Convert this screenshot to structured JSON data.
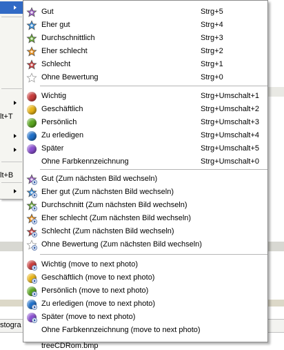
{
  "background": {
    "parent_menu_shortcuts": [
      "lt+T",
      "lt+B"
    ],
    "file_label": "treeCDRom.bmp",
    "histogram_label": "stogra"
  },
  "groups": [
    {
      "items": [
        {
          "label": "Gut",
          "shortcut": "Strg+5",
          "icon": "star-purple-icon",
          "color": "#9b5fc0"
        },
        {
          "label": "Eher gut",
          "shortcut": "Strg+4",
          "icon": "star-blue-icon",
          "color": "#3c8fd8"
        },
        {
          "label": "Durchschnittlich",
          "shortcut": "Strg+3",
          "icon": "star-green-icon",
          "color": "#6aa83a"
        },
        {
          "label": "Eher schlecht",
          "shortcut": "Strg+2",
          "icon": "star-orange-icon",
          "color": "#e8901e"
        },
        {
          "label": "Schlecht",
          "shortcut": "Strg+1",
          "icon": "star-red-icon",
          "color": "#c84040"
        },
        {
          "label": "Ohne Bewertung",
          "shortcut": "Strg+0",
          "icon": "star-empty-icon",
          "color": "#ffffff"
        }
      ]
    },
    {
      "items": [
        {
          "label": "Wichtig",
          "shortcut": "Strg+Umschalt+1",
          "icon": "circle-red-icon",
          "color": "#c83c3c"
        },
        {
          "label": "Geschäftlich",
          "shortcut": "Strg+Umschalt+2",
          "icon": "circle-yellow-icon",
          "color": "#e8b418"
        },
        {
          "label": "Persönlich",
          "shortcut": "Strg+Umschalt+3",
          "icon": "circle-green-icon",
          "color": "#5aa620"
        },
        {
          "label": "Zu erledigen",
          "shortcut": "Strg+Umschalt+4",
          "icon": "circle-blue-icon",
          "color": "#1f6fc8"
        },
        {
          "label": "Später",
          "shortcut": "Strg+Umschalt+5",
          "icon": "circle-purple-icon",
          "color": "#8a4fd0"
        },
        {
          "label": "Ohne Farbkennzeichnung",
          "shortcut": "Strg+Umschalt+0",
          "icon": "none",
          "color": ""
        }
      ]
    },
    {
      "items": [
        {
          "label": "Gut (Zum nächsten Bild wechseln)",
          "shortcut": "",
          "icon": "star-purple-next-icon",
          "color": "#9b5fc0"
        },
        {
          "label": "Eher gut (Zum nächsten Bild wechseln)",
          "shortcut": "",
          "icon": "star-blue-next-icon",
          "color": "#3c8fd8"
        },
        {
          "label": "Durchschnitt (Zum nächsten Bild wechseln)",
          "shortcut": "",
          "icon": "star-green-next-icon",
          "color": "#6aa83a"
        },
        {
          "label": "Eher schlecht (Zum nächsten Bild wechseln)",
          "shortcut": "",
          "icon": "star-orange-next-icon",
          "color": "#e8901e"
        },
        {
          "label": "Schlecht (Zum nächsten Bild wechseln)",
          "shortcut": "",
          "icon": "star-red-next-icon",
          "color": "#c84040"
        },
        {
          "label": "Ohne Bewertung (Zum nächsten Bild wechseln)",
          "shortcut": "",
          "icon": "star-empty-next-icon",
          "color": "#ffffff"
        }
      ]
    },
    {
      "items": [
        {
          "label": "Wichtig (move to next photo)",
          "shortcut": "",
          "icon": "circle-red-next-icon",
          "color": "#c83c3c"
        },
        {
          "label": "Geschäftlich (move to next photo)",
          "shortcut": "",
          "icon": "circle-yellow-next-icon",
          "color": "#e8b418"
        },
        {
          "label": "Persönlich (move to next photo)",
          "shortcut": "",
          "icon": "circle-green-next-icon",
          "color": "#5aa620"
        },
        {
          "label": "Zu erledigen (move to next photo)",
          "shortcut": "",
          "icon": "circle-blue-next-icon",
          "color": "#1f6fc8"
        },
        {
          "label": "Später (move to next photo)",
          "shortcut": "",
          "icon": "circle-purple-next-icon",
          "color": "#8a4fd0"
        },
        {
          "label": "Ohne Farbkennzeichnung (move to next photo)",
          "shortcut": "",
          "icon": "none",
          "color": ""
        }
      ]
    }
  ]
}
